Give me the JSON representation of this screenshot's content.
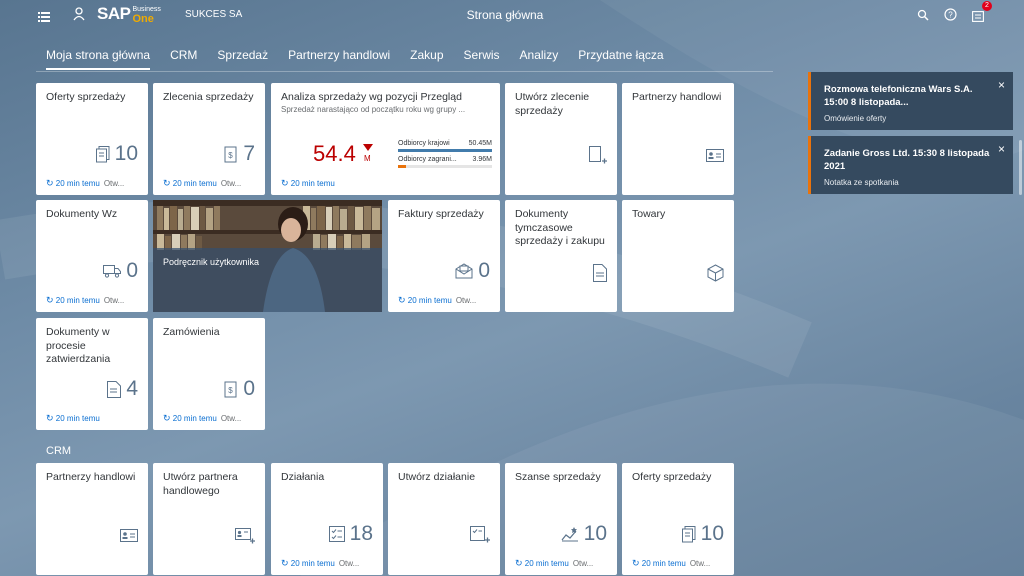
{
  "shell": {
    "logo_sap": "SAP",
    "logo_business": "Business",
    "logo_one": "One",
    "company": "SUKCES SA",
    "title": "Strona główna",
    "notification_count": "2"
  },
  "tabs": [
    {
      "label": "Moja strona główna"
    },
    {
      "label": "CRM"
    },
    {
      "label": "Sprzedaż"
    },
    {
      "label": "Partnerzy handlowi"
    },
    {
      "label": "Zakup"
    },
    {
      "label": "Serwis"
    },
    {
      "label": "Analizy"
    },
    {
      "label": "Przydatne łącza"
    }
  ],
  "refresh_text": "20 min temu",
  "open_text": "Otw...",
  "tiles": {
    "oferty": {
      "title": "Oferty sprzedaży",
      "count": "10"
    },
    "zlecenia": {
      "title": "Zlecenia sprzedaży",
      "count": "7"
    },
    "analiza": {
      "title": "Analiza sprzedaży wg pozycji Przegląd",
      "subtitle": "Sprzedaż narastająco od początku roku wg grupy ...",
      "value": "54.4",
      "unit": "M",
      "bars": [
        {
          "label": "Odbiorcy krajowi",
          "value": "50.45M",
          "fraction": 1.0,
          "color": "#427cac"
        },
        {
          "label": "Odbiorcy zagrani...",
          "value": "3.96M",
          "fraction": 0.08,
          "color": "#e9730c"
        }
      ]
    },
    "utworz_zlecenie": {
      "title": "Utwórz zlecenie sprzedaży"
    },
    "partnerzy": {
      "title": "Partnerzy handlowi"
    },
    "dokumenty_wz": {
      "title": "Dokumenty Wz",
      "count": "0"
    },
    "podrecznik": {
      "title": "Podręcznik użytkownika"
    },
    "faktury": {
      "title": "Faktury sprzedaży",
      "count": "0"
    },
    "tymczasowe": {
      "title": "Dokumenty tymczasowe sprzedaży i zakupu"
    },
    "towary": {
      "title": "Towary"
    },
    "zatwierdzanie": {
      "title": "Dokumenty w procesie zatwierdzania",
      "count": "4"
    },
    "zamowienia": {
      "title": "Zamówienia",
      "count": "0"
    }
  },
  "crm_section": {
    "title": "CRM",
    "tiles": {
      "partnerzy": {
        "title": "Partnerzy handlowi"
      },
      "utworz_partnera": {
        "title": "Utwórz partnera handlowego"
      },
      "dzialania": {
        "title": "Działania",
        "count": "18"
      },
      "utworz_dzialanie": {
        "title": "Utwórz działanie"
      },
      "szanse": {
        "title": "Szanse sprzedaży",
        "count": "10"
      },
      "oferty": {
        "title": "Oferty sprzedaży",
        "count": "10"
      }
    }
  },
  "notifications": [
    {
      "title": "Rozmowa telefoniczna      Wars S.A.      15:00      8 listopada...",
      "desc": "Omówienie oferty"
    },
    {
      "title": "Zadanie      Gross Ltd.      15:30      8 listopada 2021",
      "desc": "Notatka ze spotkania"
    }
  ],
  "colors": {
    "accent": "#0a6ed1",
    "kpi_negative": "#bb0000",
    "notif_border": "#e9730c"
  }
}
